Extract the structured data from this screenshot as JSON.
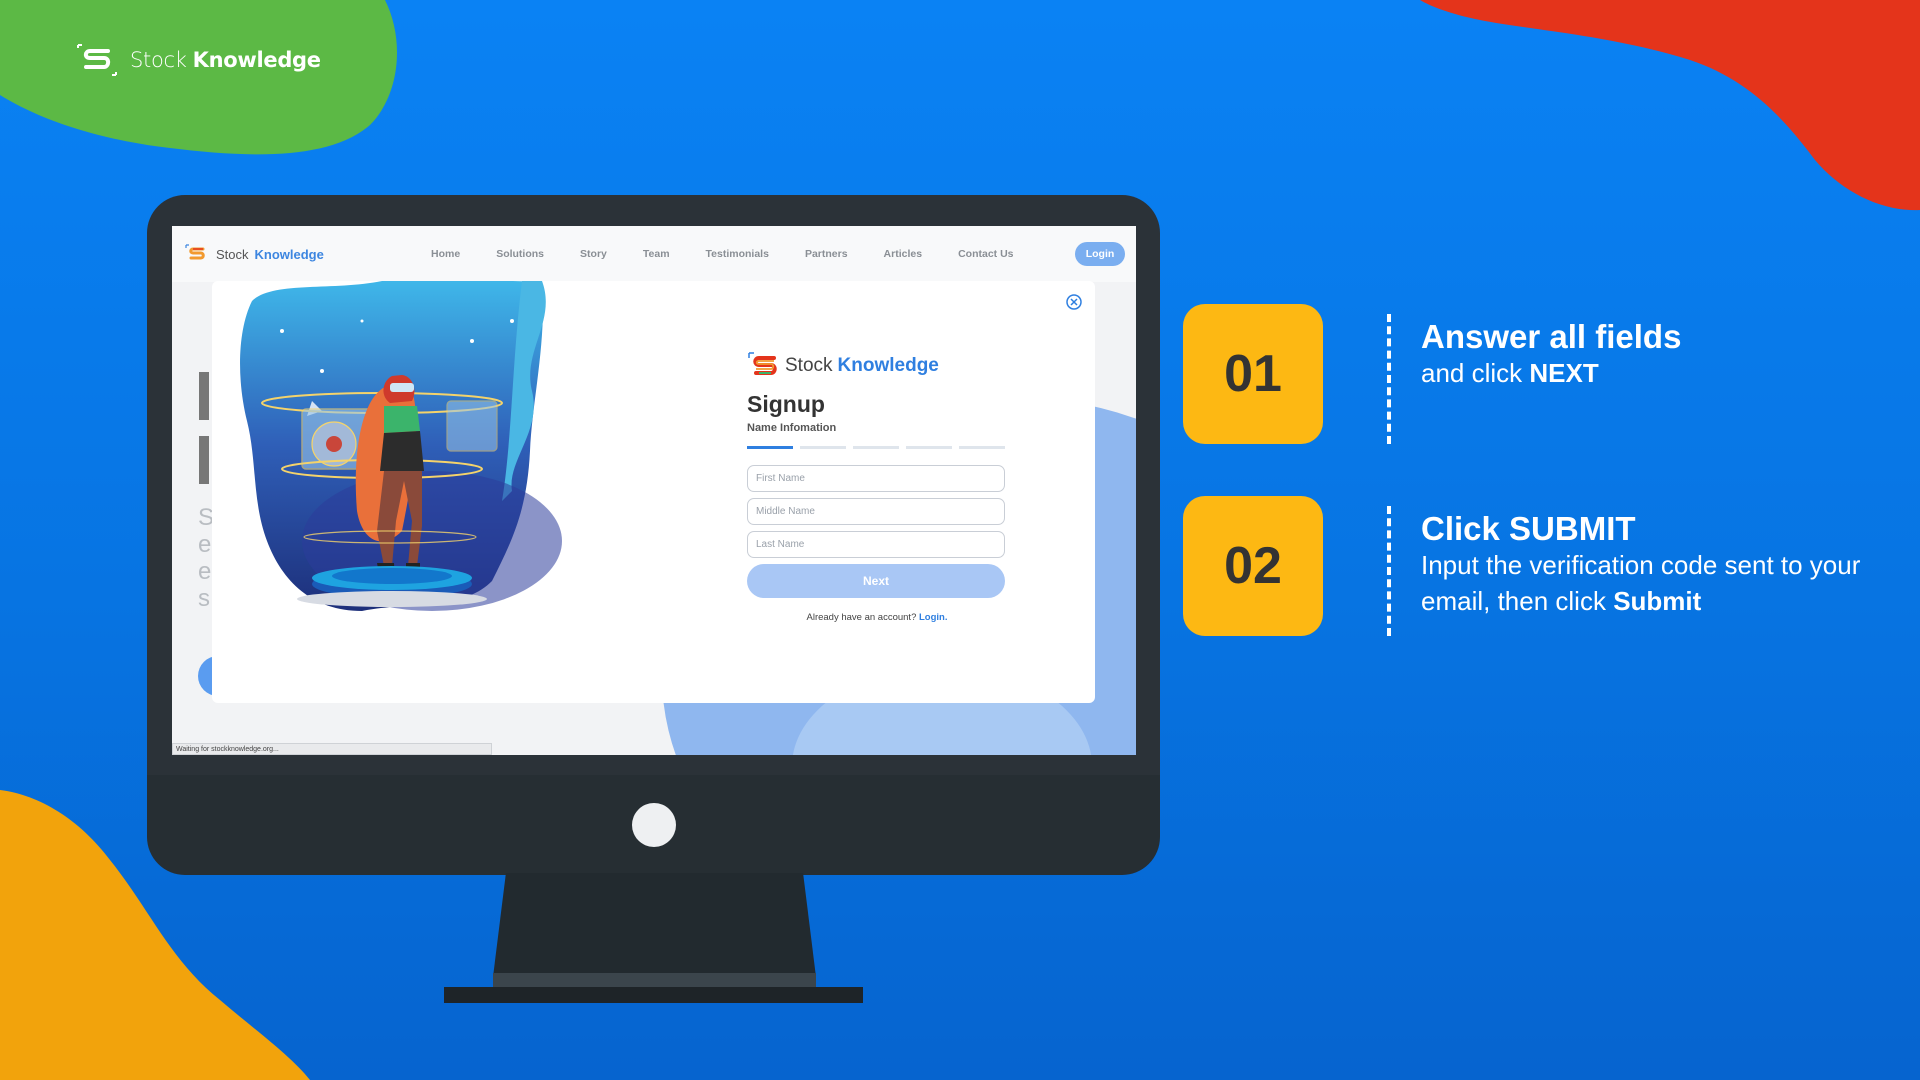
{
  "brand": {
    "word1": "Stock",
    "word2": "Knowledge"
  },
  "screen": {
    "nav": {
      "logo_word1": "Stock",
      "logo_word2": "Knowledge",
      "links": [
        "Home",
        "Solutions",
        "Story",
        "Team",
        "Testimonials",
        "Partners",
        "Articles",
        "Contact Us"
      ],
      "login": "Login"
    },
    "bg_letters": "S\ne\ne\ns",
    "status_text": "Waiting for stockknowledge.org...",
    "modal": {
      "logo_word1": "Stock",
      "logo_word2": "Knowledge",
      "title": "Signup",
      "subtitle": "Name Infomation",
      "steps_total": 5,
      "steps_active": 1,
      "fields": [
        {
          "placeholder": "First Name"
        },
        {
          "placeholder": "Middle Name"
        },
        {
          "placeholder": "Last Name"
        }
      ],
      "next_label": "Next",
      "already_text": "Already have an account?",
      "login_link": "Login."
    }
  },
  "instructions": [
    {
      "number": "01",
      "heading": "Answer all fields",
      "line1_pre": "and click ",
      "line1_bold": "NEXT"
    },
    {
      "number": "02",
      "heading": "Click SUBMIT",
      "line1_pre": "Input the verification code sent to your",
      "line2_pre": "email, then click ",
      "line2_bold": "Submit"
    }
  ],
  "colors": {
    "background": "#0a82f4",
    "blob_green": "#5cb945",
    "blob_red": "#e4341b",
    "blob_orange": "#f2a30c",
    "step_badge": "#fdb813",
    "monitor": "#2b3238",
    "accent_blue": "#2f7fe0"
  }
}
